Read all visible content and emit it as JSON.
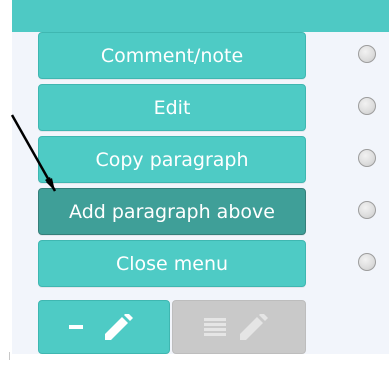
{
  "menu": {
    "items": [
      {
        "label": "Comment/note"
      },
      {
        "label": "Edit"
      },
      {
        "label": "Copy paragraph"
      },
      {
        "label": "Add paragraph above"
      },
      {
        "label": "Close menu"
      }
    ]
  },
  "icons": {
    "bottom_left": [
      "minus-icon",
      "pencil-icon"
    ],
    "bottom_right": [
      "lines-icon",
      "pencil-icon"
    ]
  },
  "colors": {
    "accent": "#4ecbc5",
    "accent_active": "#3f9f98",
    "disabled": "#c9c9c9"
  }
}
